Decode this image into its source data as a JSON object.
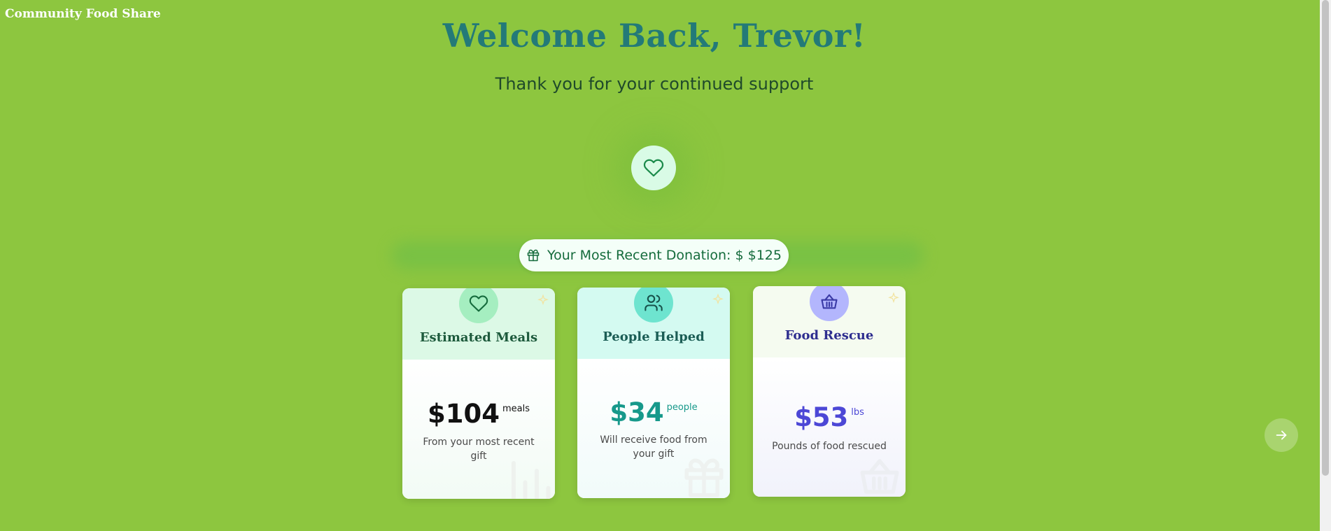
{
  "brand": "Community Food Share",
  "welcome_title": "Welcome Back, Trevor!",
  "welcome_subtitle": "Thank you for your continued support",
  "donation": {
    "label": "Your Most Recent Donation: $ $125",
    "icon": "gift-icon"
  },
  "cards": [
    {
      "title": "Estimated Meals",
      "value": "$104",
      "unit": "meals",
      "description": "From your most recent gift",
      "icon": "heart-icon",
      "watermark": "bar-chart-icon",
      "colors": {
        "header": "#dcf9e6",
        "icon_bg": "#a5eec0",
        "icon": "#156b3c",
        "title": "#1d5a3c",
        "value": "#111111"
      }
    },
    {
      "title": "People Helped",
      "value": "$34",
      "unit": "people",
      "description": "Will receive food from your gift",
      "icon": "users-icon",
      "watermark": "gift-icon",
      "colors": {
        "header": "#d4faf1",
        "icon_bg": "#6ee4cf",
        "icon": "#17514a",
        "title": "#1b5d55",
        "value": "#17998b"
      }
    },
    {
      "title": "Food Rescue",
      "value": "$53",
      "unit": "lbs",
      "description": "Pounds of food rescued",
      "icon": "basket-icon",
      "watermark": "basket-icon",
      "colors": {
        "header": "#f5fbf0",
        "icon_bg": "#b3b6fd",
        "icon": "#3a3aa6",
        "title": "#2e2e8f",
        "value": "#4c47d6"
      }
    }
  ],
  "next_button_icon": "arrow-right-icon",
  "colors": {
    "background": "#8dc63f",
    "title": "#237a78",
    "subtitle": "#1f4a2a"
  }
}
